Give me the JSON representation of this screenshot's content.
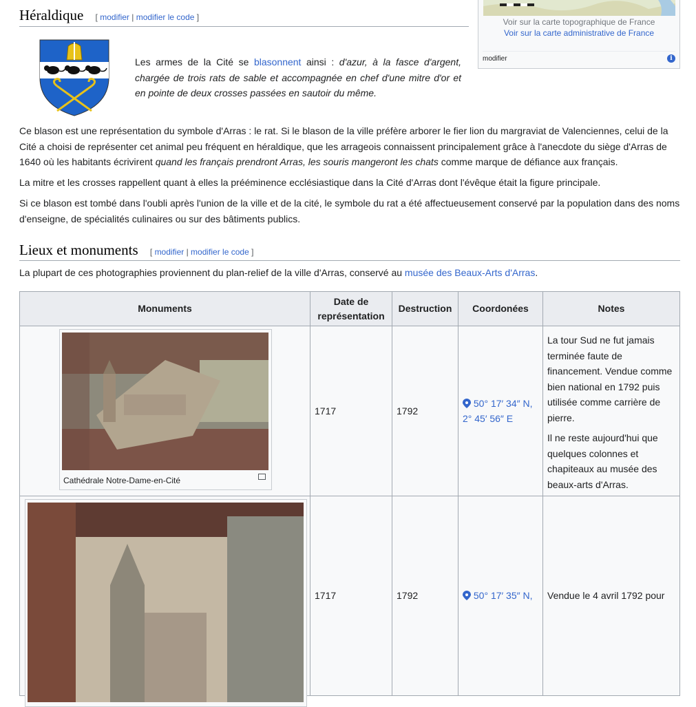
{
  "map_box": {
    "link_topo": "Voir sur la carte topographique de France",
    "link_admin": "Voir sur la carte administrative de France",
    "edit": "modifier"
  },
  "heraldique": {
    "title": "Héraldique",
    "edit": "modifier",
    "edit_code": "modifier le code",
    "blason_pre": "Les armes de la Cité se ",
    "blason_link": "blasonnent",
    "blason_post": " ainsi : ",
    "blason_italic": "d'azur, à la fasce d'argent, chargée de trois rats de sable et accompagnée en chef d'une mitre d'or et en pointe de deux crosses passées en sautoir du même.",
    "p1_a": "Ce blason est une représentation du symbole d'Arras : le rat. Si le blason de la ville préfère arborer le fier lion du margraviat de Valenciennes, celui de la Cité a choisi de représenter cet animal peu fréquent en héraldique, que les arrageois connaissent principalement grâce à l'anecdote du siège d'Arras de 1640 où les habitants écrivirent ",
    "p1_italic": "quand les français prendront Arras, les souris mangeront les chats",
    "p1_b": " comme marque de défiance aux français.",
    "p2": "La mitre et les crosses rappellent quant à elles la prééminence ecclésiastique dans la Cité d'Arras dont l'évêque était la figure principale.",
    "p3": "Si ce blason est tombé dans l'oubli après l'union de la ville et de la cité, le symbole du rat a été affectueusement conservé par la population dans des noms d'enseigne, de spécialités culinaires ou sur des bâtiments publics."
  },
  "lieux": {
    "title": "Lieux et monuments",
    "edit": "modifier",
    "edit_code": "modifier le code",
    "intro_pre": "La plupart de ces photographies proviennent du plan-relief de la ville d'Arras, conservé au ",
    "intro_link": "musée des Beaux-Arts d'Arras",
    "intro_post": "."
  },
  "table": {
    "headers": [
      "Monuments",
      "Date de représentation",
      "Destruction",
      "Coordonées",
      "Notes"
    ],
    "rows": [
      {
        "caption": "Cathédrale Notre-Dame-en-Cité",
        "date": "1717",
        "destruction": "1792",
        "coord_line1": "50° 17′ 34″ N,",
        "coord_line2": "2° 45′ 56″ E",
        "notes1": "La tour Sud ne fut jamais terminée faute de financement. Vendue comme bien national en 1792 puis utilisée comme carrière de pierre.",
        "notes2": "Il ne reste aujourd'hui que quelques colonnes et chapiteaux au musée des beaux-arts d'Arras."
      },
      {
        "date": "1717",
        "destruction": "1792",
        "coord_line1": "50° 17′ 35″ N,",
        "notes1": "Vendue le 4 avril 1792 pour"
      }
    ]
  },
  "colors": {
    "link": "#3366cc",
    "header_bg": "#eaecf0",
    "cell_bg": "#f8f9fa",
    "border": "#a2a9b1",
    "shield_blue": "#1e63c8",
    "gold": "#e8c21a"
  }
}
